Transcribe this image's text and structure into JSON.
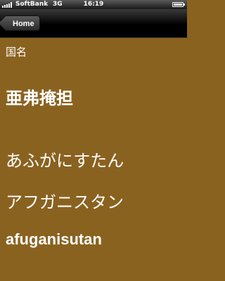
{
  "status_bar": {
    "carrier": "SoftBank",
    "network": "3G",
    "time": "16:19",
    "battery_level": 1.0
  },
  "nav_bar": {
    "back_label": "Home"
  },
  "detail": {
    "field_label": "国名",
    "kanji": "亜弗掩担",
    "hiragana": "あふがにすたん",
    "katakana": "アフガニスタン",
    "romaji": "afuganisutan"
  }
}
